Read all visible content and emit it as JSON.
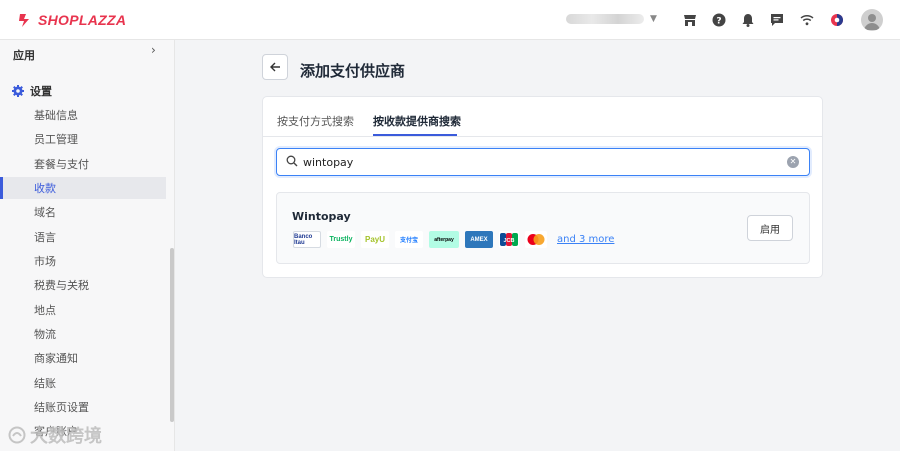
{
  "topbar": {
    "logo_text": "SHOPLAZZA",
    "brand_color": "#e8344e",
    "icons": [
      "store-icon",
      "help-icon",
      "bell-icon",
      "chat-icon",
      "wifi-icon",
      "app-badge-icon"
    ]
  },
  "sidebar": {
    "apps_label": "应用",
    "settings_label": "设置",
    "items": [
      {
        "label": "基础信息"
      },
      {
        "label": "员工管理"
      },
      {
        "label": "套餐与支付"
      },
      {
        "label": "收款",
        "active": true
      },
      {
        "label": "域名"
      },
      {
        "label": "语言"
      },
      {
        "label": "市场"
      },
      {
        "label": "税费与关税"
      },
      {
        "label": "地点"
      },
      {
        "label": "物流"
      },
      {
        "label": "商家通知"
      },
      {
        "label": "结账"
      },
      {
        "label": "结账页设置"
      },
      {
        "label": "客户账户"
      }
    ],
    "watermark": "大数跨境"
  },
  "main": {
    "title": "添加支付供应商",
    "tabs": [
      {
        "label": "按支付方式搜索",
        "active": false
      },
      {
        "label": "按收款提供商搜索",
        "active": true
      }
    ],
    "search": {
      "value": "wintopay"
    },
    "provider": {
      "name": "Wintopay",
      "payment_methods": [
        {
          "name": "banco-icon",
          "text": "Banco Itau"
        },
        {
          "name": "trustly-icon",
          "text": "Trustly"
        },
        {
          "name": "payu-icon",
          "text": "PayU"
        },
        {
          "name": "alipay-icon",
          "text": "支付宝"
        },
        {
          "name": "afterpay-icon",
          "text": "afterpay"
        },
        {
          "name": "amex-icon",
          "text": "AMEX"
        },
        {
          "name": "jcb-icon",
          "text": "JCB"
        },
        {
          "name": "mastercard-icon",
          "text": ""
        }
      ],
      "more_link": "and 3 more",
      "enable_label": "启用"
    },
    "accent_color": "#3b5bdb"
  }
}
